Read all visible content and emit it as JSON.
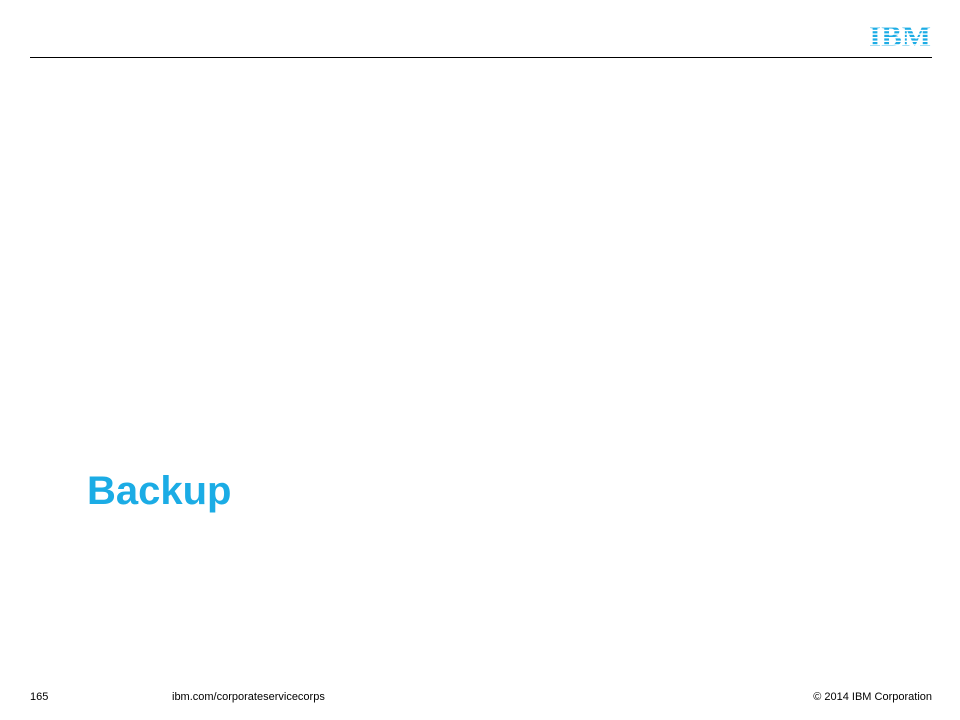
{
  "logo": {
    "text": "IBM",
    "color": "#1bace5"
  },
  "slide": {
    "title": "Backup",
    "title_color": "#1bace5"
  },
  "footer": {
    "page_number": "165",
    "url": "ibm.com/corporateservicecorps",
    "copyright": "© 2014 IBM Corporation"
  }
}
